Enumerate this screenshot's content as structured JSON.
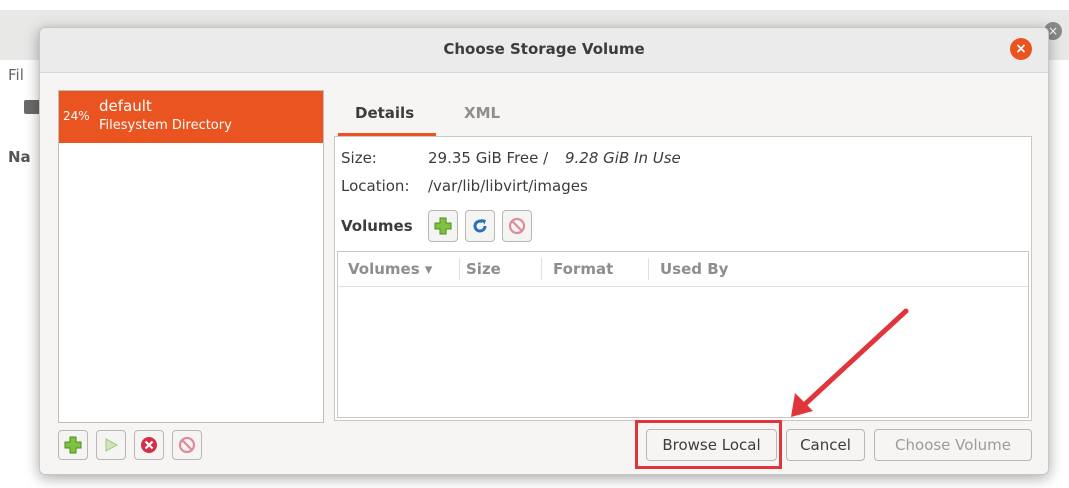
{
  "background": {
    "menu_fragment": "Fil",
    "header_fragment": "Na",
    "row_fragment": "("
  },
  "dialog": {
    "title": "Choose Storage Volume",
    "close_glyph": "×",
    "pool": {
      "usage": "24%",
      "name": "default",
      "type": "Filesystem Directory"
    },
    "tabs": [
      {
        "label": "Details",
        "active": true
      },
      {
        "label": "XML",
        "active": false
      }
    ],
    "details": {
      "size_label": "Size:",
      "size_free": "29.35 GiB Free / ",
      "size_in_use": "9.28 GiB In Use",
      "location_label": "Location:",
      "location_value": "/var/lib/libvirt/images",
      "volumes_label": "Volumes"
    },
    "volume_columns": [
      "Volumes ▾",
      "Size",
      "Format",
      "Used By"
    ],
    "buttons": {
      "browse_local": "Browse Local",
      "cancel": "Cancel",
      "choose_volume": "Choose Volume"
    }
  },
  "colors": {
    "accent": "#e95420",
    "annotation": "#e0353a",
    "add_icon": "#7fc242",
    "delete_icon": "#d52e47"
  },
  "icons": {
    "add": "add-icon",
    "play": "play-icon",
    "delete": "delete-icon",
    "stop": "stop-icon",
    "refresh": "refresh-icon"
  }
}
